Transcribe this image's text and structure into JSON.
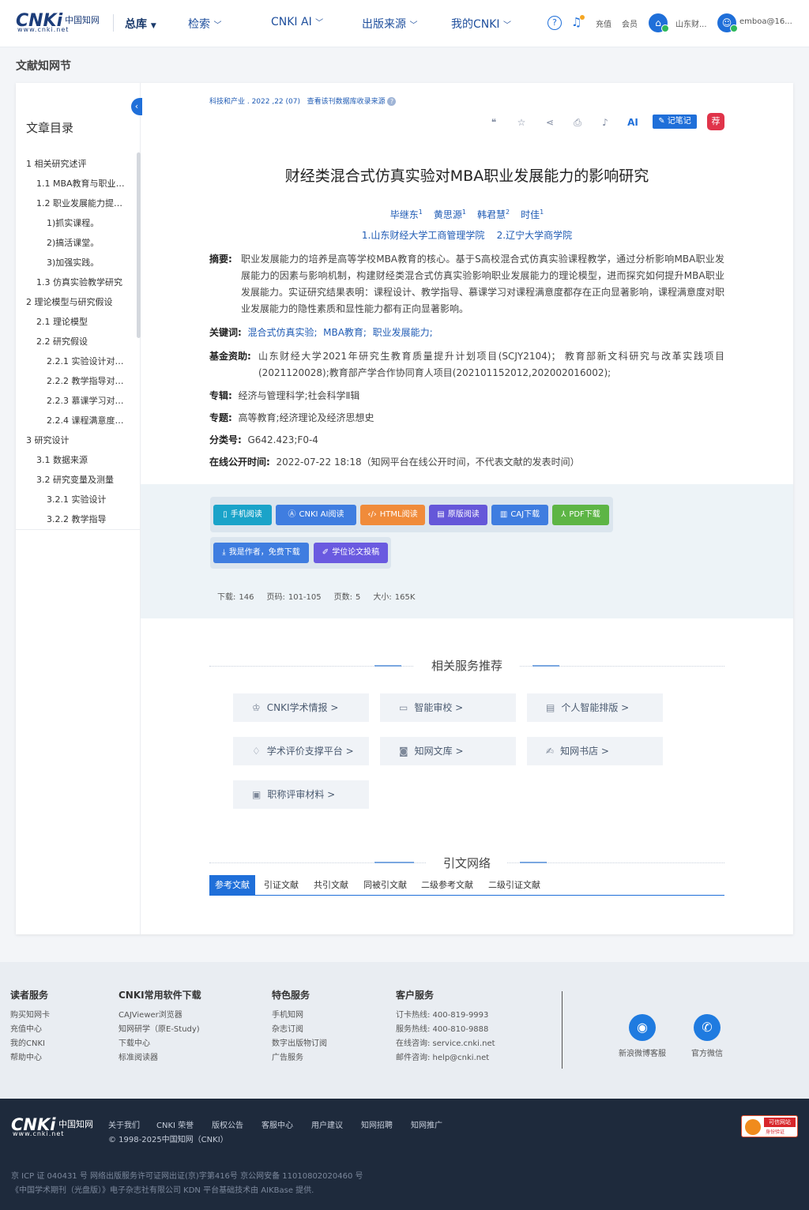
{
  "header": {
    "logo_main": "CNKi",
    "logo_cn": "中国知网",
    "logo_url": "www.cnki.net",
    "zongku": "总库",
    "nav": [
      "检索",
      "CNKI AI",
      "出版来源",
      "我的CNKI"
    ],
    "recharge": "充值",
    "member": "会员",
    "inst": "山东财...",
    "user": "emboa@16..."
  },
  "page_title": "文献知网节",
  "toc": {
    "title": "文章目录",
    "items": [
      "1 相关研究述评",
      "1.1 MBA教育与职业发...",
      "1.2 职业发展能力提升...",
      "1)抓实课程。",
      "2)搞活课堂。",
      "3)加强实践。",
      "1.3 仿真实验教学研究",
      "2 理论模型与研究假设",
      "2.1 理论模型",
      "2.2 研究假设",
      "2.2.1 实验设计对课...",
      "2.2.2 教学指导对课...",
      "2.2.3 慕课学习对课...",
      "2.2.4 课程满意度对...",
      "3 研究设计",
      "3.1 数据来源",
      "3.2 研究变量及测量",
      "3.2.1 实验设计",
      "3.2.2 教学指导"
    ]
  },
  "article": {
    "source": "科技和产业 . 2022 ,22 (07)",
    "source_link": "查看该刊数据库收录来源",
    "note_button": "记笔记",
    "recommend": "荐",
    "ai_tool": "AI",
    "title": "财经类混合式仿真实验对MBA职业发展能力的影响研究",
    "authors": [
      {
        "name": "毕继东",
        "sup": "1"
      },
      {
        "name": "黄思源",
        "sup": "1"
      },
      {
        "name": "韩君慧",
        "sup": "2"
      },
      {
        "name": "时佳",
        "sup": "1"
      }
    ],
    "affiliations": [
      "1.山东财经大学工商管理学院",
      "2.辽宁大学商学院"
    ],
    "abstract_label": "摘要:",
    "abstract": "职业发展能力的培养是高等学校MBA教育的核心。基于S高校混合式仿真实验课程教学，通过分析影响MBA职业发展能力的因素与影响机制，构建财经类混合式仿真实验影响职业发展能力的理论模型，进而探究如何提升MBA职业发展能力。实证研究结果表明：课程设计、教学指导、慕课学习对课程满意度都存在正向显著影响，课程满意度对职业发展能力的隐性素质和显性能力都有正向显著影响。",
    "keywords_label": "关键词:",
    "keywords": [
      "混合式仿真实验;",
      "MBA教育;",
      "职业发展能力;"
    ],
    "fund_label": "基金资助:",
    "fund": "山东财经大学2021年研究生教育质量提升计划项目(SCJY2104)； 教育部新文科研究与改革实践项目(2021120028);教育部产学合作协同育人项目(202101152012,202002016002);",
    "series_label": "专辑:",
    "series": "经济与管理科学;社会科学Ⅱ辑",
    "topic_label": "专题:",
    "topic": "高等教育;经济理论及经济思想史",
    "class_label": "分类号:",
    "class": "G642.423;F0-4",
    "online_label": "在线公开时间:",
    "online": "2022-07-22 18:18（知网平台在线公开时间，不代表文献的发表时间）"
  },
  "downloads": {
    "buttons": [
      "手机阅读",
      "CNKI AI阅读",
      "HTML阅读",
      "原版阅读",
      "CAJ下载",
      "PDF下载"
    ],
    "author_btn": "我是作者，免费下载",
    "thesis_btn": "学位论文投稿",
    "stats": [
      {
        "label": "下载:",
        "value": "146"
      },
      {
        "label": "页码:",
        "value": "101-105"
      },
      {
        "label": "页数:",
        "value": "5"
      },
      {
        "label": "大小:",
        "value": "165K"
      }
    ],
    "colors": {
      "phone": "#1aa3c9",
      "ai": "#3f7de0",
      "html": "#f08b3a",
      "orig": "#6557d9",
      "caj": "#3f7de0",
      "pdf": "#5db545",
      "author": "#3f7de0",
      "thesis": "#6a5ae0"
    }
  },
  "services": {
    "title": "相关服务推荐",
    "items": [
      "CNKI学术情报 >",
      "智能审校 >",
      "个人智能排版 >",
      "学术评价支撑平台 >",
      "知网文库 >",
      "知网书店 >",
      "职称评审材料 >"
    ]
  },
  "citation": {
    "title": "引文网络",
    "tabs": [
      "参考文献",
      "引证文献",
      "共引文献",
      "同被引文献",
      "二级参考文献",
      "二级引证文献"
    ]
  },
  "footer": {
    "cols": [
      {
        "h": "读者服务",
        "items": [
          "购买知网卡",
          "充值中心",
          "我的CNKI",
          "帮助中心"
        ]
      },
      {
        "h": "CNKI常用软件下载",
        "items": [
          "CAJViewer浏览器",
          "知网研学（原E-Study)",
          "下载中心",
          "标准阅读器"
        ]
      },
      {
        "h": "特色服务",
        "items": [
          "手机知网",
          "杂志订阅",
          "数字出版物订阅",
          "广告服务"
        ]
      },
      {
        "h": "客户服务",
        "items": [
          "订卡热线: 400-819-9993",
          "服务热线: 400-810-9888",
          "在线咨询: service.cnki.net",
          "邮件咨询: help@cnki.net"
        ]
      }
    ],
    "social": [
      "新浪微博客服",
      "官方微信"
    ],
    "bottom_links": [
      "关于我们",
      "CNKI 荣誉",
      "版权公告",
      "客服中心",
      "用户建议",
      "知网招聘",
      "知网推广"
    ],
    "copyright": "© 1998-2025中国知网（CNKI）",
    "badge_main": "可信网站",
    "badge_sub": "身份验证",
    "icp1": "京 ICP 证 040431 号  网络出版服务许可证网出证(京)字第416号  京公网安备 11010802020460 号",
    "icp2": "《中国学术期刊（光盘版）》电子杂志社有限公司  KDN 平台基础技术由 AIKBase 提供."
  }
}
